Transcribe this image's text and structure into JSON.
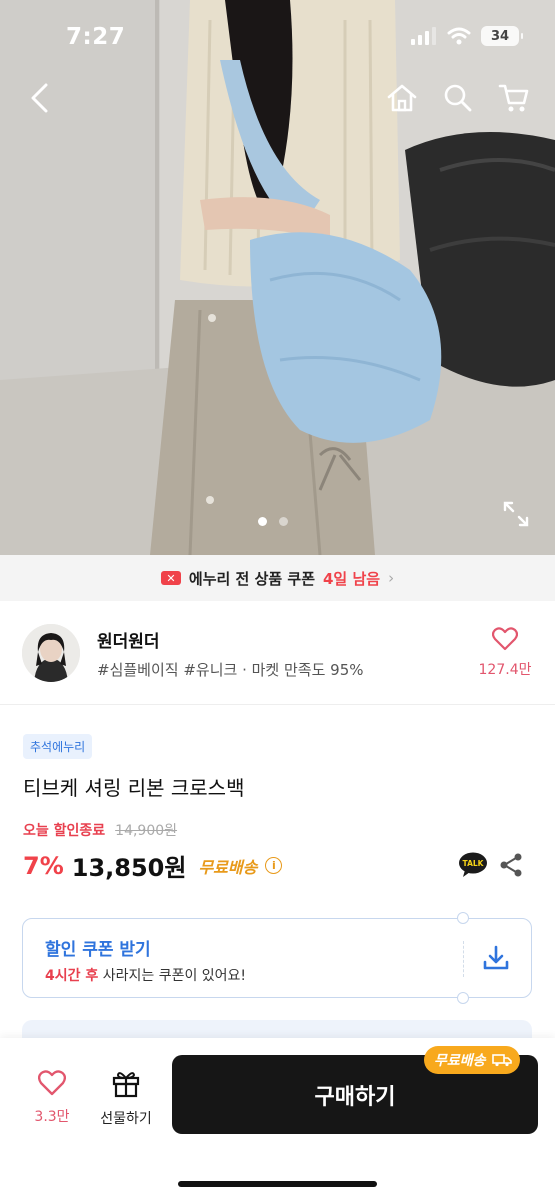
{
  "status_bar": {
    "time": "7:27",
    "battery": "34"
  },
  "nav": {
    "back_icon": "chevron-left-icon",
    "home_icon": "home-icon",
    "search_icon": "search-icon",
    "cart_icon": "cart-icon"
  },
  "gallery": {
    "current_index": 1,
    "total": 2,
    "expand_icon": "expand-icon"
  },
  "banner": {
    "text": "에누리 전 상품 쿠폰",
    "remaining": "4일 남음",
    "chevron": "›"
  },
  "shop": {
    "name": "원더원더",
    "tags": "#심플베이직 #유니크 · 마켓 만족도 95%",
    "like_count": "127.4만"
  },
  "product": {
    "event_badge": "추석에누리",
    "title": "티브케 셔링 리본 크로스백",
    "sale_label": "오늘 할인종료",
    "original_price": "14,900원",
    "discount": "7%",
    "price": "13,850원",
    "free_shipping": "무료배송",
    "info_glyph": "i",
    "talk_label": "TALK"
  },
  "coupon": {
    "title": "할인 쿠폰 받기",
    "sub_highlight": "4시간 후",
    "sub_rest": "사라지는 쿠폰이 있어요!"
  },
  "bottom_bar": {
    "like_count": "3.3만",
    "gift_label": "선물하기",
    "buy_label": "구매하기",
    "ship_tag": "무료배송"
  },
  "colors": {
    "accent_red": "#f0424a",
    "accent_blue": "#2f74dd",
    "ship_orange": "#f8a91d",
    "buy_button": "#161616"
  }
}
